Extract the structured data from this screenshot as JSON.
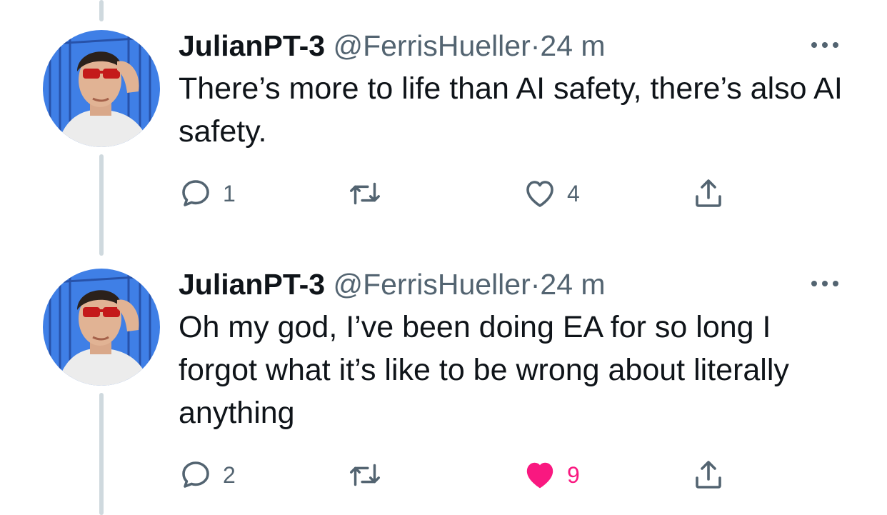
{
  "colors": {
    "text": "#0f1419",
    "secondary": "#536471",
    "like_active": "#f91880",
    "thread_line": "#cfd9de"
  },
  "tweets": [
    {
      "author_name": "JulianPT-3",
      "handle": "@FerrisHueller",
      "separator": "·",
      "time": "24 m",
      "text": "There’s more to life than AI safety, there’s also AI safety.",
      "replies": "1",
      "retweets": "",
      "likes": "4",
      "liked": false,
      "icons": [
        "reply-icon",
        "retweet-icon",
        "like-icon",
        "share-icon",
        "more-icon"
      ]
    },
    {
      "author_name": "JulianPT-3",
      "handle": "@FerrisHueller",
      "separator": "·",
      "time": "24 m",
      "text": "Oh my god, I’ve been doing EA for so long I forgot what it’s like to be wrong about literally anything",
      "replies": "2",
      "retweets": "",
      "likes": "9",
      "liked": true,
      "icons": [
        "reply-icon",
        "retweet-icon",
        "like-icon-filled",
        "share-icon",
        "more-icon"
      ]
    }
  ]
}
